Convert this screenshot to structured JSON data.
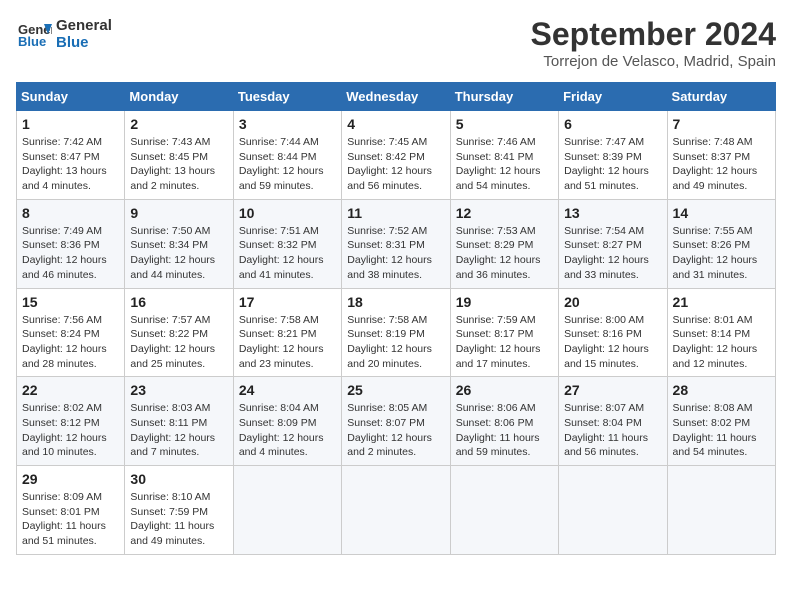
{
  "header": {
    "logo_line1": "General",
    "logo_line2": "Blue",
    "month": "September 2024",
    "location": "Torrejon de Velasco, Madrid, Spain"
  },
  "days_of_week": [
    "Sunday",
    "Monday",
    "Tuesday",
    "Wednesday",
    "Thursday",
    "Friday",
    "Saturday"
  ],
  "weeks": [
    [
      {
        "day": "1",
        "sunrise": "7:42 AM",
        "sunset": "8:47 PM",
        "daylight": "13 hours and 4 minutes."
      },
      {
        "day": "2",
        "sunrise": "7:43 AM",
        "sunset": "8:45 PM",
        "daylight": "13 hours and 2 minutes."
      },
      {
        "day": "3",
        "sunrise": "7:44 AM",
        "sunset": "8:44 PM",
        "daylight": "12 hours and 59 minutes."
      },
      {
        "day": "4",
        "sunrise": "7:45 AM",
        "sunset": "8:42 PM",
        "daylight": "12 hours and 56 minutes."
      },
      {
        "day": "5",
        "sunrise": "7:46 AM",
        "sunset": "8:41 PM",
        "daylight": "12 hours and 54 minutes."
      },
      {
        "day": "6",
        "sunrise": "7:47 AM",
        "sunset": "8:39 PM",
        "daylight": "12 hours and 51 minutes."
      },
      {
        "day": "7",
        "sunrise": "7:48 AM",
        "sunset": "8:37 PM",
        "daylight": "12 hours and 49 minutes."
      }
    ],
    [
      {
        "day": "8",
        "sunrise": "7:49 AM",
        "sunset": "8:36 PM",
        "daylight": "12 hours and 46 minutes."
      },
      {
        "day": "9",
        "sunrise": "7:50 AM",
        "sunset": "8:34 PM",
        "daylight": "12 hours and 44 minutes."
      },
      {
        "day": "10",
        "sunrise": "7:51 AM",
        "sunset": "8:32 PM",
        "daylight": "12 hours and 41 minutes."
      },
      {
        "day": "11",
        "sunrise": "7:52 AM",
        "sunset": "8:31 PM",
        "daylight": "12 hours and 38 minutes."
      },
      {
        "day": "12",
        "sunrise": "7:53 AM",
        "sunset": "8:29 PM",
        "daylight": "12 hours and 36 minutes."
      },
      {
        "day": "13",
        "sunrise": "7:54 AM",
        "sunset": "8:27 PM",
        "daylight": "12 hours and 33 minutes."
      },
      {
        "day": "14",
        "sunrise": "7:55 AM",
        "sunset": "8:26 PM",
        "daylight": "12 hours and 31 minutes."
      }
    ],
    [
      {
        "day": "15",
        "sunrise": "7:56 AM",
        "sunset": "8:24 PM",
        "daylight": "12 hours and 28 minutes."
      },
      {
        "day": "16",
        "sunrise": "7:57 AM",
        "sunset": "8:22 PM",
        "daylight": "12 hours and 25 minutes."
      },
      {
        "day": "17",
        "sunrise": "7:58 AM",
        "sunset": "8:21 PM",
        "daylight": "12 hours and 23 minutes."
      },
      {
        "day": "18",
        "sunrise": "7:58 AM",
        "sunset": "8:19 PM",
        "daylight": "12 hours and 20 minutes."
      },
      {
        "day": "19",
        "sunrise": "7:59 AM",
        "sunset": "8:17 PM",
        "daylight": "12 hours and 17 minutes."
      },
      {
        "day": "20",
        "sunrise": "8:00 AM",
        "sunset": "8:16 PM",
        "daylight": "12 hours and 15 minutes."
      },
      {
        "day": "21",
        "sunrise": "8:01 AM",
        "sunset": "8:14 PM",
        "daylight": "12 hours and 12 minutes."
      }
    ],
    [
      {
        "day": "22",
        "sunrise": "8:02 AM",
        "sunset": "8:12 PM",
        "daylight": "12 hours and 10 minutes."
      },
      {
        "day": "23",
        "sunrise": "8:03 AM",
        "sunset": "8:11 PM",
        "daylight": "12 hours and 7 minutes."
      },
      {
        "day": "24",
        "sunrise": "8:04 AM",
        "sunset": "8:09 PM",
        "daylight": "12 hours and 4 minutes."
      },
      {
        "day": "25",
        "sunrise": "8:05 AM",
        "sunset": "8:07 PM",
        "daylight": "12 hours and 2 minutes."
      },
      {
        "day": "26",
        "sunrise": "8:06 AM",
        "sunset": "8:06 PM",
        "daylight": "11 hours and 59 minutes."
      },
      {
        "day": "27",
        "sunrise": "8:07 AM",
        "sunset": "8:04 PM",
        "daylight": "11 hours and 56 minutes."
      },
      {
        "day": "28",
        "sunrise": "8:08 AM",
        "sunset": "8:02 PM",
        "daylight": "11 hours and 54 minutes."
      }
    ],
    [
      {
        "day": "29",
        "sunrise": "8:09 AM",
        "sunset": "8:01 PM",
        "daylight": "11 hours and 51 minutes."
      },
      {
        "day": "30",
        "sunrise": "8:10 AM",
        "sunset": "7:59 PM",
        "daylight": "11 hours and 49 minutes."
      },
      null,
      null,
      null,
      null,
      null
    ]
  ]
}
